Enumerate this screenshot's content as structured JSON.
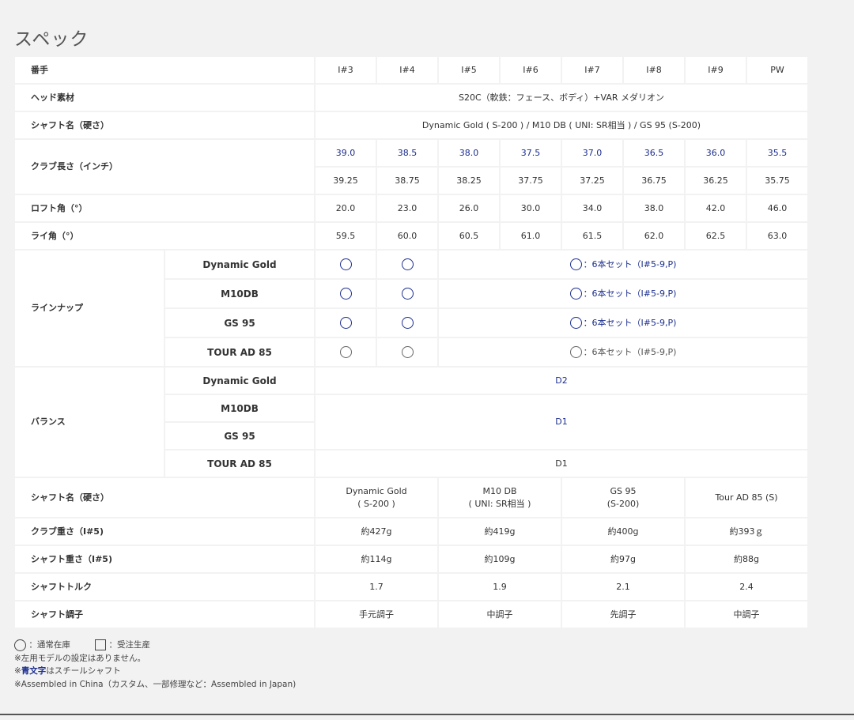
{
  "title": "スペック",
  "head": {
    "label": "番手",
    "numbers": [
      "I#3",
      "I#4",
      "I#5",
      "I#6",
      "I#7",
      "I#8",
      "I#9",
      "PW"
    ]
  },
  "head_material": {
    "label": "ヘッド素材",
    "value": "S20C（軟鉄：フェース、ボディ）+VAR メダリオン"
  },
  "shaft_name_top": {
    "label": "シャフト名（硬さ）",
    "value": "Dynamic Gold ( S-200 ) / M10 DB ( UNI: SR相当 ) / GS 95 (S-200)"
  },
  "club_length": {
    "label": "クラブ長さ（インチ）",
    "steel": [
      "39.0",
      "38.5",
      "38.0",
      "37.5",
      "37.0",
      "36.5",
      "36.0",
      "35.5"
    ],
    "carbon": [
      "39.25",
      "38.75",
      "38.25",
      "37.75",
      "37.25",
      "36.75",
      "36.25",
      "35.75"
    ]
  },
  "loft": {
    "label": "ロフト角（°）",
    "values": [
      "20.0",
      "23.0",
      "26.0",
      "30.0",
      "34.0",
      "38.0",
      "42.0",
      "46.0"
    ]
  },
  "lie": {
    "label": "ライ角（°）",
    "values": [
      "59.5",
      "60.0",
      "60.5",
      "61.0",
      "61.5",
      "62.0",
      "62.5",
      "63.0"
    ]
  },
  "lineup": {
    "label": "ラインナップ",
    "set_text": "：6本セット（I#5-9,P)",
    "rows": [
      {
        "name": "Dynamic Gold"
      },
      {
        "name": "M10DB"
      },
      {
        "name": "GS 95"
      },
      {
        "name": "TOUR AD 85"
      }
    ]
  },
  "balance": {
    "label": "バランス",
    "rows": [
      "Dynamic Gold",
      "M10DB",
      "GS 95",
      "TOUR AD 85"
    ],
    "d2": "D2",
    "d1_mid": "D1",
    "d1_bottom": "D1"
  },
  "shaft_specs": {
    "name_label": "シャフト名（硬さ）",
    "names": [
      {
        "l1": "Dynamic Gold",
        "l2": "( S-200 )"
      },
      {
        "l1": "M10 DB",
        "l2": "( UNI: SR相当 )"
      },
      {
        "l1": "GS 95",
        "l2": "(S-200)"
      },
      {
        "l1": "Tour AD 85 (S)",
        "l2": ""
      }
    ],
    "club_weight_label": "クラブ重さ（I#5)",
    "club_weight": [
      "約427g",
      "約419g",
      "約400g",
      "約393ｇ"
    ],
    "shaft_weight_label": "シャフト重さ（I#5)",
    "shaft_weight": [
      "約114g",
      "約109g",
      "約97g",
      "約88g"
    ],
    "torque_label": "シャフトトルク",
    "torque": [
      "1.7",
      "1.9",
      "2.1",
      "2.4"
    ],
    "kick_label": "シャフト調子",
    "kick": [
      "手元調子",
      "中調子",
      "先調子",
      "中調子"
    ]
  },
  "legend": {
    "circle_text": "：通常在庫",
    "square_text": "：受注生産",
    "note1": "※左用モデルの設定はありません。",
    "note2_prefix": "※",
    "note2_blue": "青文字",
    "note2_suffix": "はスチールシャフト",
    "note3": "※Assembled in China（カスタム、一部修理など：Assembled in Japan)"
  }
}
